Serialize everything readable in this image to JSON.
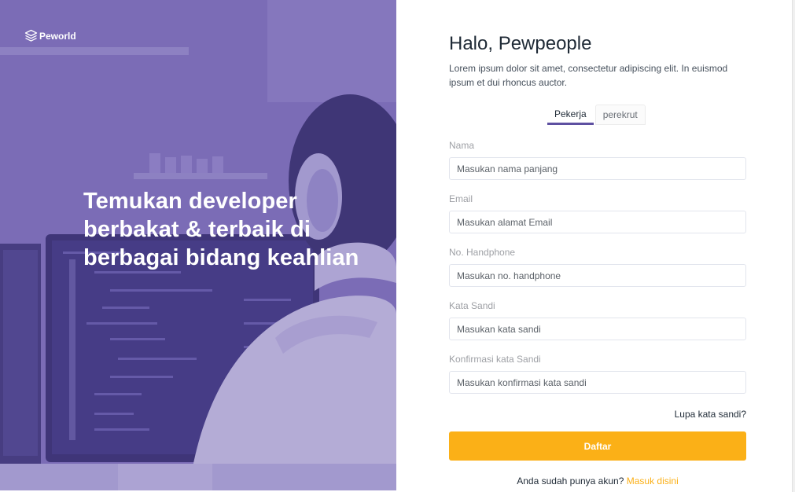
{
  "brand": {
    "name": "Peworld"
  },
  "hero": {
    "headline": "Temukan developer berbakat & terbaik di berbagai bidang keahlian"
  },
  "form": {
    "greeting": "Halo, Pewpeople",
    "intro": "Lorem ipsum dolor sit amet, consectetur adipiscing elit. In euismod ipsum et dui rhoncus auctor.",
    "tabs": [
      {
        "label": "Pekerja",
        "active": true
      },
      {
        "label": "perekrut",
        "active": false
      }
    ],
    "fields": {
      "name": {
        "label": "Nama",
        "placeholder": "Masukan nama panjang"
      },
      "email": {
        "label": "Email",
        "placeholder": "Masukan alamat Email"
      },
      "phone": {
        "label": "No. Handphone",
        "placeholder": "Masukan no. handphone"
      },
      "password": {
        "label": "Kata Sandi",
        "placeholder": "Masukan kata sandi"
      },
      "confirm": {
        "label": "Konfirmasi kata Sandi",
        "placeholder": "Masukan konfirmasi kata sandi"
      }
    },
    "forgot_label": "Lupa kata sandi?",
    "submit_label": "Daftar",
    "login_prompt": "Anda sudah punya akun?",
    "login_link": "Masuk disini"
  },
  "colors": {
    "primary": "#5e50a1",
    "accent": "#fbb017",
    "text": "#1f2a36",
    "muted": "#9ea0a5"
  }
}
